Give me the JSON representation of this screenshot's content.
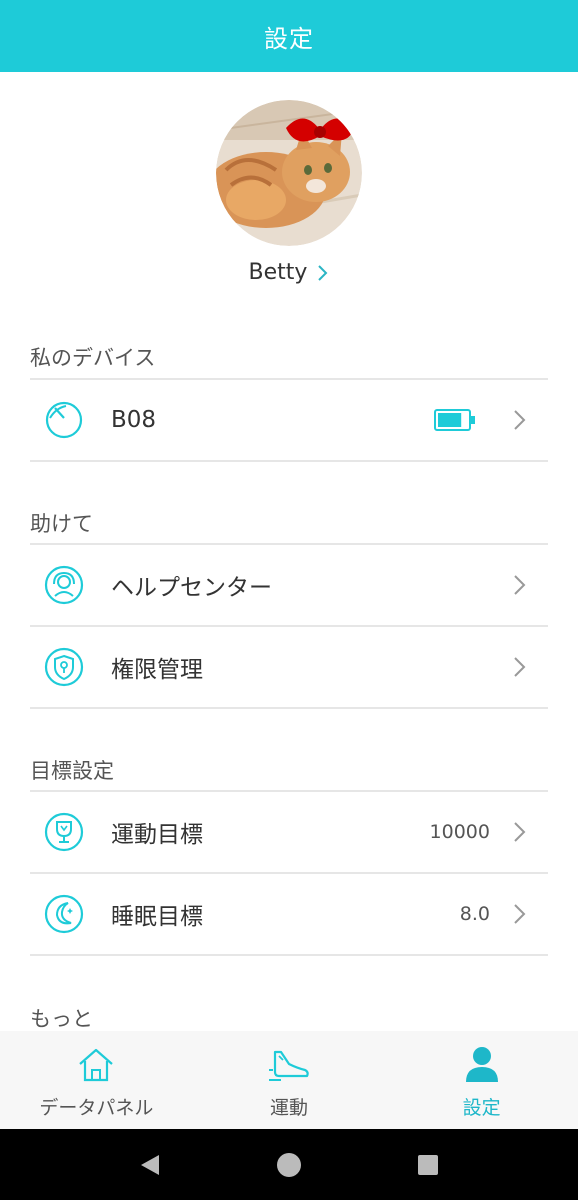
{
  "header": {
    "title": "設定"
  },
  "profile": {
    "name": "Betty",
    "avatar_icon": "cat-with-red-bow-photo"
  },
  "sections": {
    "device": {
      "title": "私のデバイス",
      "items": [
        {
          "label": "B08",
          "icon": "watch-icon",
          "battery_icon": "battery-icon",
          "battery_level": 0.8
        }
      ]
    },
    "help": {
      "title": "助けて",
      "items": [
        {
          "label": "ヘルプセンター",
          "icon": "headset-icon"
        },
        {
          "label": "権限管理",
          "icon": "shield-lock-icon"
        }
      ]
    },
    "goals": {
      "title": "目標設定",
      "items": [
        {
          "label": "運動目標",
          "value": "10000",
          "icon": "trophy-icon"
        },
        {
          "label": "睡眠目標",
          "value": "8.0",
          "icon": "moon-icon"
        }
      ]
    },
    "more": {
      "title": "もっと"
    }
  },
  "tabbar": {
    "tabs": [
      {
        "label": "データパネル",
        "icon": "home-icon",
        "active": false
      },
      {
        "label": "運動",
        "icon": "shoe-icon",
        "active": false
      },
      {
        "label": "設定",
        "icon": "person-icon",
        "active": true
      }
    ]
  },
  "colors": {
    "accent": "#1ecbd8",
    "active_tab": "#1eb7c9"
  }
}
